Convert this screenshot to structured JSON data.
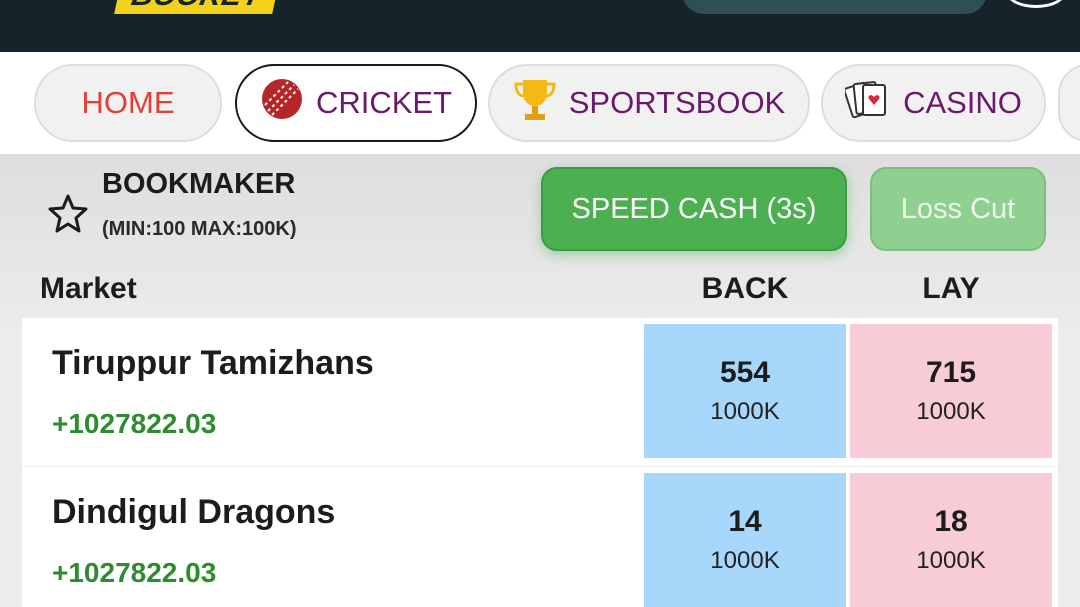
{
  "header": {
    "logo_text": "BOOKEY"
  },
  "nav": {
    "items": [
      {
        "label": "HOME",
        "icon": "none",
        "color": "#e0403a"
      },
      {
        "label": "CRICKET",
        "icon": "cricket-ball-icon",
        "color": "#6b1a6b",
        "active": true
      },
      {
        "label": "SPORTSBOOK",
        "icon": "trophy-icon",
        "color": "#6b1a6b"
      },
      {
        "label": "CASINO",
        "icon": "playing-cards-icon",
        "color": "#6b1a6b"
      }
    ]
  },
  "bookmaker": {
    "title": "BOOKMAKER",
    "limits": "(MIN:100 MAX:100K)",
    "speed_cash_label": "SPEED CASH (3s)",
    "loss_cut_label": "Loss Cut"
  },
  "table": {
    "col_market": "Market",
    "col_back": "BACK",
    "col_lay": "LAY",
    "rows": [
      {
        "team": "Tiruppur Tamizhans",
        "pnl": "+1027822.03",
        "back_price": "554",
        "back_size": "1000K",
        "lay_price": "715",
        "lay_size": "1000K"
      },
      {
        "team": "Dindigul Dragons",
        "pnl": "+1027822.03",
        "back_price": "14",
        "back_size": "1000K",
        "lay_price": "18",
        "lay_size": "1000K"
      }
    ]
  },
  "colors": {
    "back": "#a7d8fb",
    "lay": "#f8ccd6",
    "profit": "#2e8b2e",
    "accent_green": "#4caf50"
  }
}
